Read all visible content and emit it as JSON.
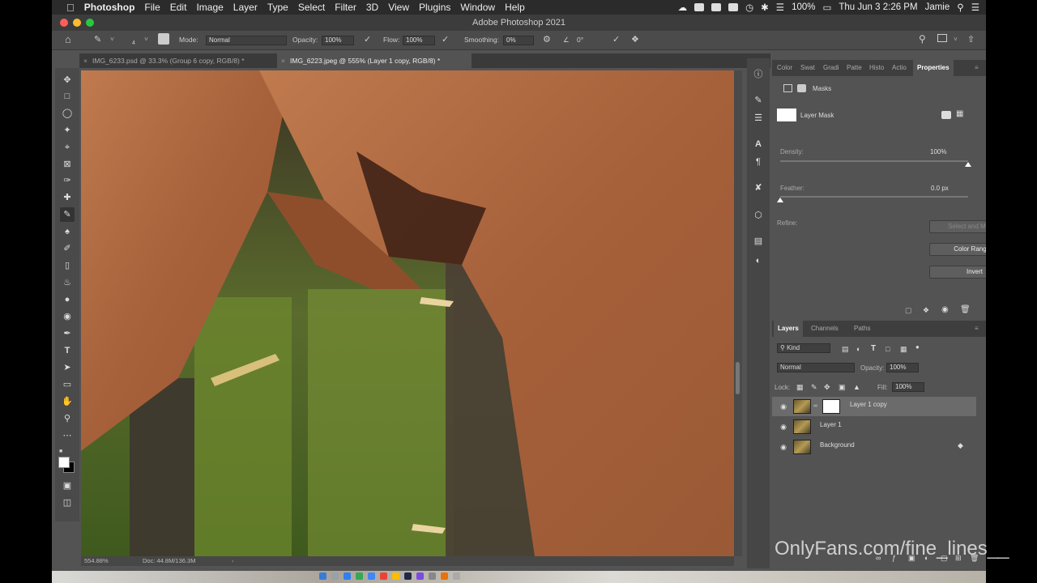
{
  "menubar": {
    "app_name": "Photoshop",
    "items": [
      "File",
      "Edit",
      "Image",
      "Layer",
      "Type",
      "Select",
      "Filter",
      "3D",
      "View",
      "Plugins",
      "Window",
      "Help"
    ],
    "battery": "100%",
    "datetime": "Thu Jun 3  2:26 PM",
    "user": "Jamie"
  },
  "window": {
    "title": "Adobe Photoshop 2021"
  },
  "options": {
    "brush_size": "4",
    "mode_label": "Mode:",
    "mode_value": "Normal",
    "opacity_label": "Opacity:",
    "opacity_value": "100%",
    "flow_label": "Flow:",
    "flow_value": "100%",
    "smoothing_label": "Smoothing:",
    "smoothing_value": "0%",
    "angle_value": "0°"
  },
  "tabs": [
    {
      "label": "IMG_6233.psd @ 33.3% (Group 6 copy, RGB/8) *"
    },
    {
      "label": "IMG_6223.jpeg @ 555% (Layer 1 copy, RGB/8) *"
    }
  ],
  "status": {
    "zoom": "554.88%",
    "doc": "Doc: 44.8M/136.3M"
  },
  "properties": {
    "tabs": [
      "Color",
      "Swat",
      "Gradi",
      "Patte",
      "Histo",
      "Actio",
      "Properties"
    ],
    "section_title": "Masks",
    "mask_label": "Layer Mask",
    "density_label": "Density:",
    "density_value": "100%",
    "density_level": 1.0,
    "feather_label": "Feather:",
    "feather_value": "0.0 px",
    "feather_level": 0.0,
    "refine_label": "Refine:",
    "select_mask_label": "Select and Mask...",
    "color_range_label": "Color Range...",
    "invert_label": "Invert"
  },
  "layers": {
    "tabs": [
      "Layers",
      "Channels",
      "Paths"
    ],
    "kind_label": "Kind",
    "blend_mode": "Normal",
    "opacity_label": "Opacity:",
    "opacity_value": "100%",
    "lock_label": "Lock:",
    "fill_label": "Fill:",
    "fill_value": "100%",
    "items": [
      {
        "name": "Layer 1 copy",
        "selected": true,
        "has_mask": true
      },
      {
        "name": "Layer 1",
        "selected": false,
        "has_mask": false
      },
      {
        "name": "Background",
        "selected": false,
        "has_mask": false,
        "locked": true
      }
    ]
  },
  "watermark": "OnlyFans.com/fine_lines__",
  "colors": {
    "panel_bg": "#535353",
    "selected_row": "#6b6b6b",
    "menubar_bg": "#2b2b2b"
  }
}
